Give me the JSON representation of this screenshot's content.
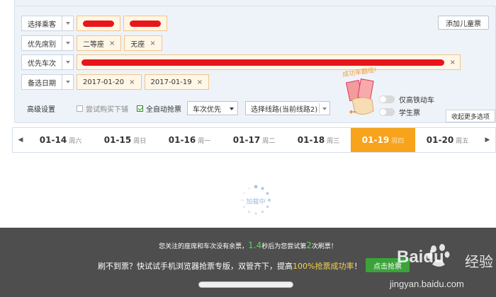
{
  "form": {
    "passenger_label": "选择乘客",
    "seat_label": "优先席别",
    "seat_tags": [
      "二等座",
      "无座"
    ],
    "train_label": "优先车次",
    "date_label": "备选日期",
    "date_tags": [
      "2017-01-20",
      "2017-01-19"
    ],
    "add_child_label": "添加儿童票",
    "remove_glyph": "×"
  },
  "advanced": {
    "label": "高级设置",
    "try_lower_label": "尝试购买下铺",
    "auto_grab_label": "全自动抢票",
    "priority_select": "车次优先",
    "route_select": "选择线路(当前线路2)",
    "promo_text": "成功率翻倍!",
    "high_speed_label": "仅高铁动车",
    "student_label": "学生票",
    "collapse_label": "收起更多选项"
  },
  "dates": [
    {
      "date": "01-14",
      "weekday": "周六"
    },
    {
      "date": "01-15",
      "weekday": "周日"
    },
    {
      "date": "01-16",
      "weekday": "周一"
    },
    {
      "date": "01-17",
      "weekday": "周二"
    },
    {
      "date": "01-18",
      "weekday": "周三"
    },
    {
      "date": "01-19",
      "weekday": "周四",
      "active": true
    },
    {
      "date": "01-20",
      "weekday": "周五"
    }
  ],
  "loading_text": "加载中",
  "status": {
    "pre": "您关注的座席和车次没有余票，",
    "seconds": "1.4",
    "mid": "秒后为您尝试第",
    "count": "2",
    "post": "次刷票！"
  },
  "promo_bar": {
    "pre": "刷不到票？快试试手机浏览器抢票专版，双管齐下，提高",
    "highlight": "100%抢票成功率",
    "post": "！",
    "button": "点击抢票"
  },
  "watermark": {
    "brand": "Baidu",
    "cn": "经验",
    "site": "jingyan.baidu.com"
  },
  "colors": {
    "accent": "#f7a31c",
    "redaction": "#e8161b",
    "green": "#3aa43a"
  }
}
